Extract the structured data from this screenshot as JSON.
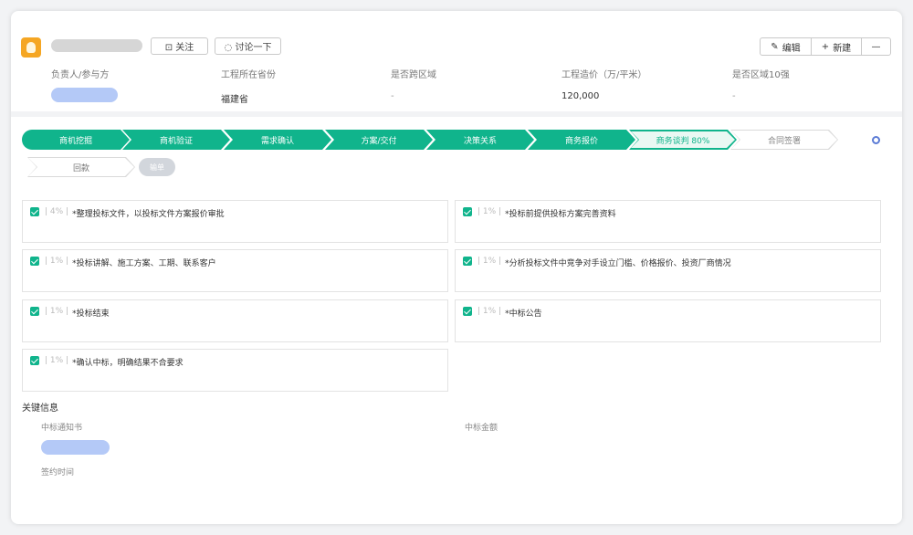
{
  "header": {
    "follow_label": "⊡ 关注",
    "discuss_label": "◌ 讨论一下",
    "edit_label": "编辑",
    "new_label": "新建",
    "more_label": "—",
    "fields": [
      {
        "label": "负责人/参与方",
        "value": ""
      },
      {
        "label": "工程所在省份",
        "value": "福建省"
      },
      {
        "label": "是否跨区域",
        "value": "-"
      },
      {
        "label": "工程造价（万/平米）",
        "value": "120,000"
      },
      {
        "label": "是否区域10强",
        "value": "-"
      }
    ]
  },
  "stages": [
    {
      "label": "商机挖掘",
      "state": "done"
    },
    {
      "label": "商机验证",
      "state": "done"
    },
    {
      "label": "需求确认",
      "state": "done"
    },
    {
      "label": "方案/交付",
      "state": "done"
    },
    {
      "label": "决策关系",
      "state": "done"
    },
    {
      "label": "商务报价",
      "state": "done"
    },
    {
      "label": "商务谈判 80%",
      "state": "current"
    },
    {
      "label": "合同签署",
      "state": "todo"
    }
  ],
  "stage2": {
    "label": "回款",
    "pill": "输单"
  },
  "tasks": [
    {
      "pct": "| 4% |",
      "text": "*整理投标文件，以投标文件方案报价审批"
    },
    {
      "pct": "| 1% |",
      "text": "*投标前提供投标方案完善资料"
    },
    {
      "pct": "| 1% |",
      "text": "*投标讲解、施工方案、工期、联系客户"
    },
    {
      "pct": "| 1% |",
      "text": "*分析投标文件中竞争对手设立门槛、价格报价、投资厂商情况"
    },
    {
      "pct": "| 1% |",
      "text": "*投标结束"
    },
    {
      "pct": "| 1% |",
      "text": "*中标公告"
    },
    {
      "pct": "| 1% |",
      "text": "*确认中标，明确结果不合要求"
    }
  ],
  "key_info": {
    "title": "关键信息",
    "field1_label": "中标通知书",
    "field2_label": "中标金额",
    "field3_label": "签约时间"
  }
}
